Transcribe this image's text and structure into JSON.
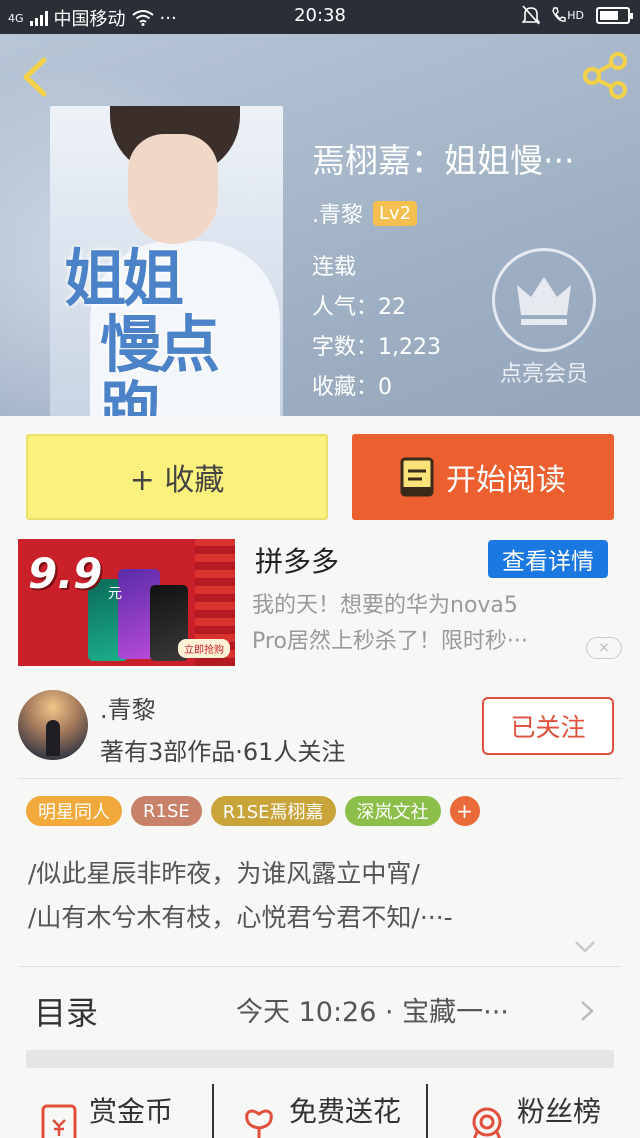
{
  "status_bar": {
    "network": "4G",
    "carrier": "中国移动",
    "more": "···",
    "time": "20:38",
    "hd": "HD"
  },
  "header": {
    "book_title": "焉栩嘉：姐姐慢···",
    "cover_title_line1": "姐姐",
    "cover_title_line2": "慢点跑",
    "author": ".青黎",
    "level": "Lv2",
    "status": "连载",
    "popularity_label": "人气：",
    "popularity": "22",
    "words_label": "字数：",
    "words": "1,223",
    "favorites_label": "收藏：",
    "favorites": "0",
    "vip_label": "点亮会员"
  },
  "actions": {
    "collect": "+ 收藏",
    "read": "开始阅读"
  },
  "ad": {
    "price": "9.9",
    "price_unit": "元",
    "buy_now": "立即抢购",
    "brand": "拼多多",
    "details_button": "查看详情",
    "desc_line1": "我的天！想要的华为nova5",
    "desc_line2": "Pro居然上秒杀了！限时秒···",
    "close": "×"
  },
  "author_section": {
    "name": ".青黎",
    "stats": "著有3部作品·61人关注",
    "follow_button": "已关注"
  },
  "tags": [
    {
      "label": "明星同人",
      "color": "#f2a93b"
    },
    {
      "label": "R1SE",
      "color": "#c9826a"
    },
    {
      "label": "R1SE焉栩嘉",
      "color": "#c8a43a"
    },
    {
      "label": "深岚文社",
      "color": "#8bbf4a"
    }
  ],
  "tag_add": "+",
  "synopsis": {
    "line1": "/似此星辰非昨夜，为谁风露立中宵/",
    "line2": "/山有木兮木有枝，心悦君兮君不知/···-"
  },
  "toc": {
    "label": "目录",
    "latest": "今天 10:26 · 宝藏一···"
  },
  "bottom_actions": {
    "reward": "赏金币",
    "flowers": "免费送花",
    "fans": "粉丝榜"
  },
  "colors": {
    "accent_orange": "#ec5f2e",
    "collect_yellow": "#fbf17d",
    "link_blue": "#1b78e1",
    "follow_red": "#e04f3b"
  }
}
